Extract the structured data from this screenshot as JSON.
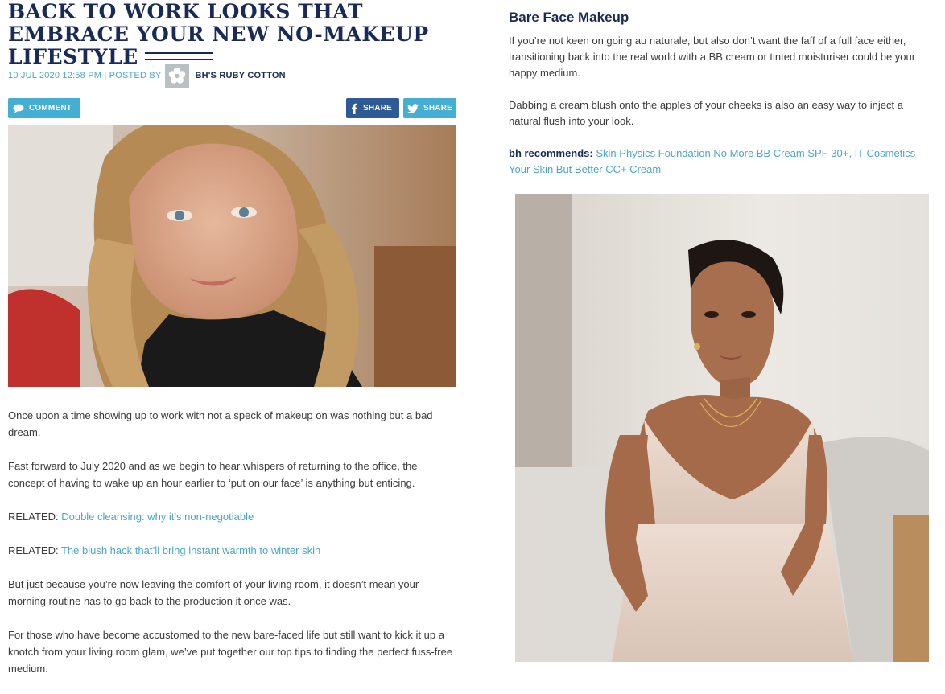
{
  "article": {
    "title": "BACK TO WORK LOOKS THAT EMBRACE YOUR NEW NO-MAKEUP LIFESTYLE",
    "meta_date": "10 JUL 2020 12:58 PM | POSTED BY",
    "author": "BH'S RUBY COTTON",
    "comment_label": "COMMENT",
    "share_facebook_label": "SHARE",
    "share_twitter_label": "SHARE",
    "paragraphs": [
      "Once upon a time showing up to work with not a speck of makeup on was nothing but a bad dream.",
      "Fast forward to July 2020 and as we begin to hear whispers of returning to the office, the concept of having to wake up an hour earlier to ‘put on our face’ is anything but enticing."
    ],
    "related": [
      {
        "prefix": "RELATED: ",
        "link": "Double cleansing: why it’s non-negotiable"
      },
      {
        "prefix": "RELATED: ",
        "link": "The blush hack that’ll bring instant warmth to winter skin"
      }
    ],
    "paragraphs_after": [
      "But just because you’re now leaving the comfort of your living room, it doesn’t mean your morning routine has to go back to the production it once was.",
      "For those who have become accustomed to the new bare-faced life but still want to kick it up a knotch from your living room glam, we’ve put together our top tips to finding the perfect fuss-free medium."
    ]
  },
  "section": {
    "title": "Bare Face Makeup",
    "paragraphs": [
      "If you’re not keen on going au naturale, but also don’t want the faff of a full face either, transitioning back into the real world with a BB cream or tinted moisturiser could be your happy medium.",
      "Dabbing a cream blush onto the apples of your cheeks is also an easy way to inject a natural flush into your look."
    ],
    "recommends_label": "bh recommends:",
    "recommends_link_1": "Skin Physics Foundation No More BB Cream SPF 30+",
    "recommends_separator": ", ",
    "recommends_link_2": "IT Cosmetics Your Skin But Better CC+ Cream"
  },
  "colors": {
    "navy": "#1a2a57",
    "link_blue": "#4ba7c9",
    "facebook_blue": "#2e5b95",
    "twitter_blue": "#45aed3"
  },
  "icons": [
    "flower-avatar-icon",
    "comment-bubble-icon",
    "facebook-icon",
    "twitter-icon"
  ]
}
